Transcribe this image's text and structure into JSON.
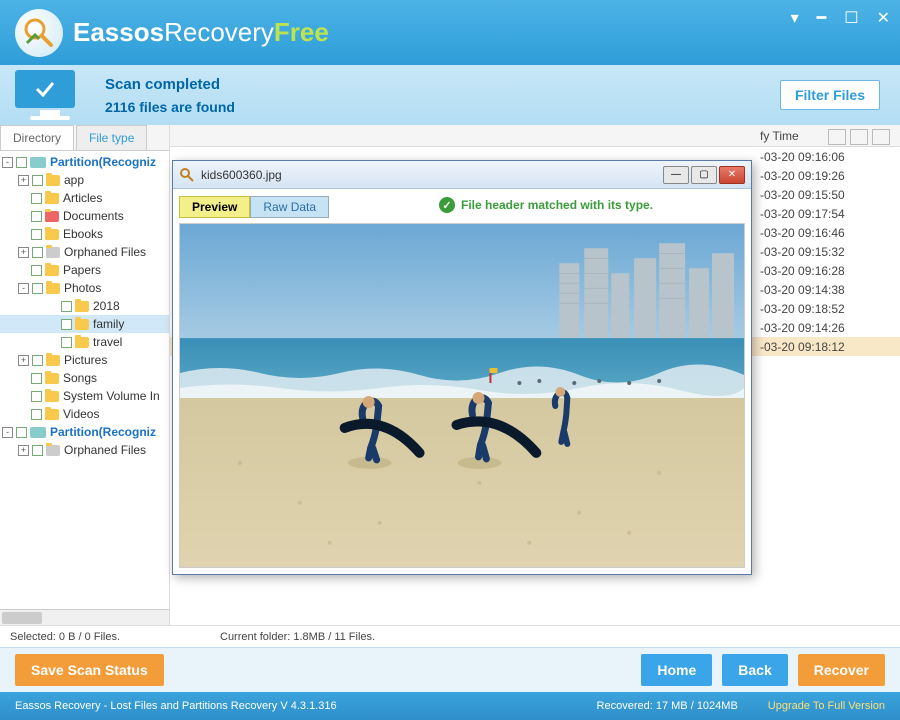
{
  "brand": {
    "e": "Eassos",
    "r": "Recovery",
    "f": "Free"
  },
  "scan": {
    "title": "Scan completed",
    "subtitle": "2116 files are found"
  },
  "buttons": {
    "filter": "Filter Files",
    "save_scan": "Save Scan Status",
    "home": "Home",
    "back": "Back",
    "recover": "Recover"
  },
  "tabs": {
    "directory": "Directory",
    "filetype": "File type"
  },
  "tree": [
    {
      "indent": 0,
      "exp": "-",
      "icon": "drive",
      "label": "Partition(Recogniz",
      "part": true
    },
    {
      "indent": 1,
      "exp": "+",
      "icon": "folder",
      "label": "app"
    },
    {
      "indent": 1,
      "exp": "",
      "icon": "folder",
      "label": "Articles"
    },
    {
      "indent": 1,
      "exp": "",
      "icon": "docs",
      "label": "Documents"
    },
    {
      "indent": 1,
      "exp": "",
      "icon": "folder",
      "label": "Ebooks"
    },
    {
      "indent": 1,
      "exp": "+",
      "icon": "orph",
      "label": "Orphaned Files"
    },
    {
      "indent": 1,
      "exp": "",
      "icon": "folder",
      "label": "Papers"
    },
    {
      "indent": 1,
      "exp": "-",
      "icon": "folder",
      "label": "Photos"
    },
    {
      "indent": 2,
      "exp": "",
      "icon": "folder",
      "label": "2018"
    },
    {
      "indent": 2,
      "exp": "",
      "icon": "folder",
      "label": "family",
      "sel": true
    },
    {
      "indent": 2,
      "exp": "",
      "icon": "folder",
      "label": "travel"
    },
    {
      "indent": 1,
      "exp": "+",
      "icon": "folder",
      "label": "Pictures"
    },
    {
      "indent": 1,
      "exp": "",
      "icon": "folder",
      "label": "Songs"
    },
    {
      "indent": 1,
      "exp": "",
      "icon": "folder",
      "label": "System Volume In"
    },
    {
      "indent": 1,
      "exp": "",
      "icon": "folder",
      "label": "Videos"
    },
    {
      "indent": 0,
      "exp": "-",
      "icon": "drive",
      "label": "Partition(Recogniz",
      "part": true
    },
    {
      "indent": 1,
      "exp": "+",
      "icon": "orph",
      "label": "Orphaned Files"
    }
  ],
  "table": {
    "header_time": "fy Time",
    "rows": [
      "-03-20 09:16:06",
      "-03-20 09:19:26",
      "-03-20 09:15:50",
      "-03-20 09:17:54",
      "-03-20 09:16:46",
      "-03-20 09:15:32",
      "-03-20 09:16:28",
      "-03-20 09:14:38",
      "-03-20 09:18:52",
      "-03-20 09:14:26",
      "-03-20 09:18:12"
    ],
    "selected_index": 10
  },
  "status": {
    "left": "Selected: 0 B / 0 Files.",
    "right": "Current folder:  1.8MB / 11 Files."
  },
  "bottom": {
    "product": "Eassos Recovery - Lost Files and Partitions Recovery  V 4.3.1.316",
    "recovered": "Recovered: 17 MB / 1024MB",
    "upgrade": "Upgrade To Full Version"
  },
  "preview": {
    "title": "kids600360.jpg",
    "tab_preview": "Preview",
    "tab_raw": "Raw Data",
    "status": "File header matched with its type."
  }
}
